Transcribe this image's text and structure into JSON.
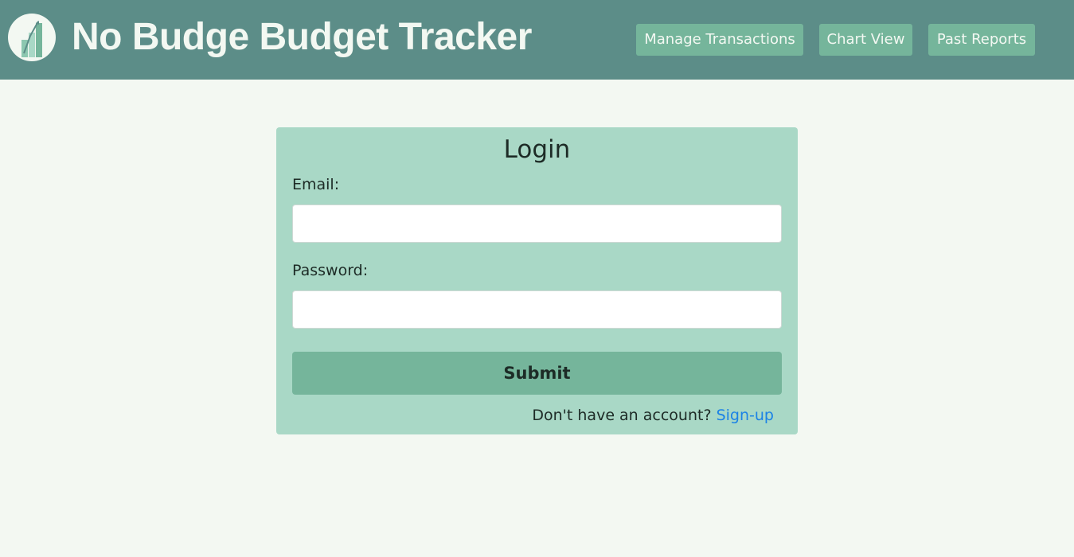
{
  "header": {
    "title": "No Budge Budget Tracker",
    "logo_icon": "budget-chart-logo-icon",
    "nav": [
      {
        "label": "Manage Transactions"
      },
      {
        "label": "Chart View"
      },
      {
        "label": "Past Reports"
      }
    ]
  },
  "login": {
    "title": "Login",
    "email_label": "Email:",
    "email_value": "",
    "password_label": "Password:",
    "password_value": "",
    "submit_label": "Submit",
    "signup_prompt": "Don't have an account?",
    "signup_link": "Sign-up"
  },
  "colors": {
    "header_bg": "#5c8d88",
    "accent": "#75b59b",
    "card_bg": "#a9d8c6",
    "page_bg": "#f3f8f2",
    "link": "#1b82e6"
  }
}
